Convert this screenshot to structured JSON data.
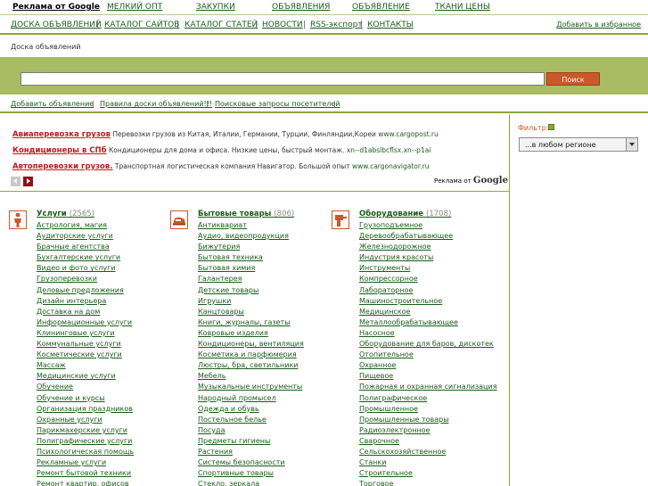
{
  "adbar": {
    "label": "Реклама от Google",
    "links": [
      "МЕЛКИЙ ОПТ",
      "ЗАКУПКИ",
      "ОБЪЯВЛЕНИЯ",
      "ОБЪЯВЛЕНИЕ",
      "ТКАНИ ЦЕНЫ"
    ]
  },
  "topnav": {
    "items": [
      "ДОСКА ОБЪЯВЛЕНИЙ",
      "КАТАЛОГ САЙТОВ",
      "КАТАЛОГ СТАТЕЙ",
      "НОВОСТИ",
      "RSS-экспорт",
      "КОНТАКТЫ"
    ],
    "separator": "|",
    "favorites": "Добавить в избранное"
  },
  "breadcrumb": "Доска объявлений",
  "search": {
    "value": "",
    "button": "Поиск"
  },
  "sublinks": {
    "items": [
      "Добавить объявление",
      "Правила доски объявлений!!!",
      "Поисковые запросы посетителей"
    ],
    "separator": "|"
  },
  "filter": {
    "label": "Фильтр:",
    "selected": "...в любом регионе"
  },
  "ads": [
    {
      "title": "Авиаперевозка грузов",
      "text": "Перевозки грузов из Китая, Италии, Германии, Турции, Финляндии,Кореи",
      "url": "www.cargopost.ru"
    },
    {
      "title": "Кондиционеры в СПб",
      "text": "Кондиционеры для дома и офиса. Низкие цены, быстрый монтаж.",
      "url": "xn--d1abslbcflsx.xn--p1ai"
    },
    {
      "title": "Автоперевозки грузов.",
      "text": "Транспортная логистическая компания Навигатор. Большой опыт",
      "url": "www.cargonavigator.ru"
    }
  ],
  "ads_badge": {
    "prefix": "Реклама от",
    "brand": "Google"
  },
  "categories": [
    {
      "title": "Услуги",
      "count": "(2565)",
      "items": [
        "Астрология, магия",
        "Аудиторские услуги",
        "Брачные агентства",
        "Бухгалтерские услуги",
        "Видео и фото услуги",
        "Грузоперевозки",
        "Деловые предложения",
        "Дизайн интерьера",
        "Доставка на дом",
        "Информационные услуги",
        "Клининговые услуги",
        "Коммунальные услуги",
        "Косметические услуги",
        "Массаж",
        "Медицинские услуги",
        "Обучение",
        "Обучение и курсы",
        "Организация праздников",
        "Охранные услуги",
        "Парикмахерские услуги",
        "Полиграфические услуги",
        "Психологическая помощь",
        "Рекламные услуги",
        "Ремонт бытовой техники",
        "Ремонт квартир, офисов"
      ]
    },
    {
      "title": "Бытовые товары",
      "count": "(806)",
      "items": [
        "Антиквариат",
        "Аудио, видеопродукция",
        "Бижутерия",
        "Бытовая техника",
        "Бытовая химия",
        "Галантерея",
        "Детские товары",
        "Игрушки",
        "Канцтовары",
        "Книги, журналы, газеты",
        "Ковровые изделия",
        "Кондиционеры, вентиляция",
        "Косметика и парфюмерия",
        "Люстры, бра, светильники",
        "Мебель",
        "Музыкальные инструменты",
        "Народный промысел",
        "Одежда и обувь",
        "Постельное белье",
        "Посуда",
        "Предметы гигиены",
        "Растения",
        "Системы безопасности",
        "Спортивные товары",
        "Стекло, зеркала"
      ]
    },
    {
      "title": "Оборудование",
      "count": "(1708)",
      "items": [
        "Грузоподъемное",
        "Деревообрабатывающее",
        "Железнодорожное",
        "Индустрия красоты",
        "Инструменты",
        "Компрессорное",
        "Лабораторное",
        "Машиностроительное",
        "Медицинское",
        "Металлообрабатывающее",
        "Насосное",
        "Оборудование для баров, дискотек",
        "Отопительное",
        "Охранное",
        "Пищевое",
        "Пожарная и охранная сигнализация",
        "Полиграфическое",
        "Промышленное",
        "Промышленные товары",
        "Радиоэлектронное",
        "Сварочное",
        "Сельскохозяйственное",
        "Станки",
        "Строительное",
        "Торговое"
      ]
    }
  ]
}
